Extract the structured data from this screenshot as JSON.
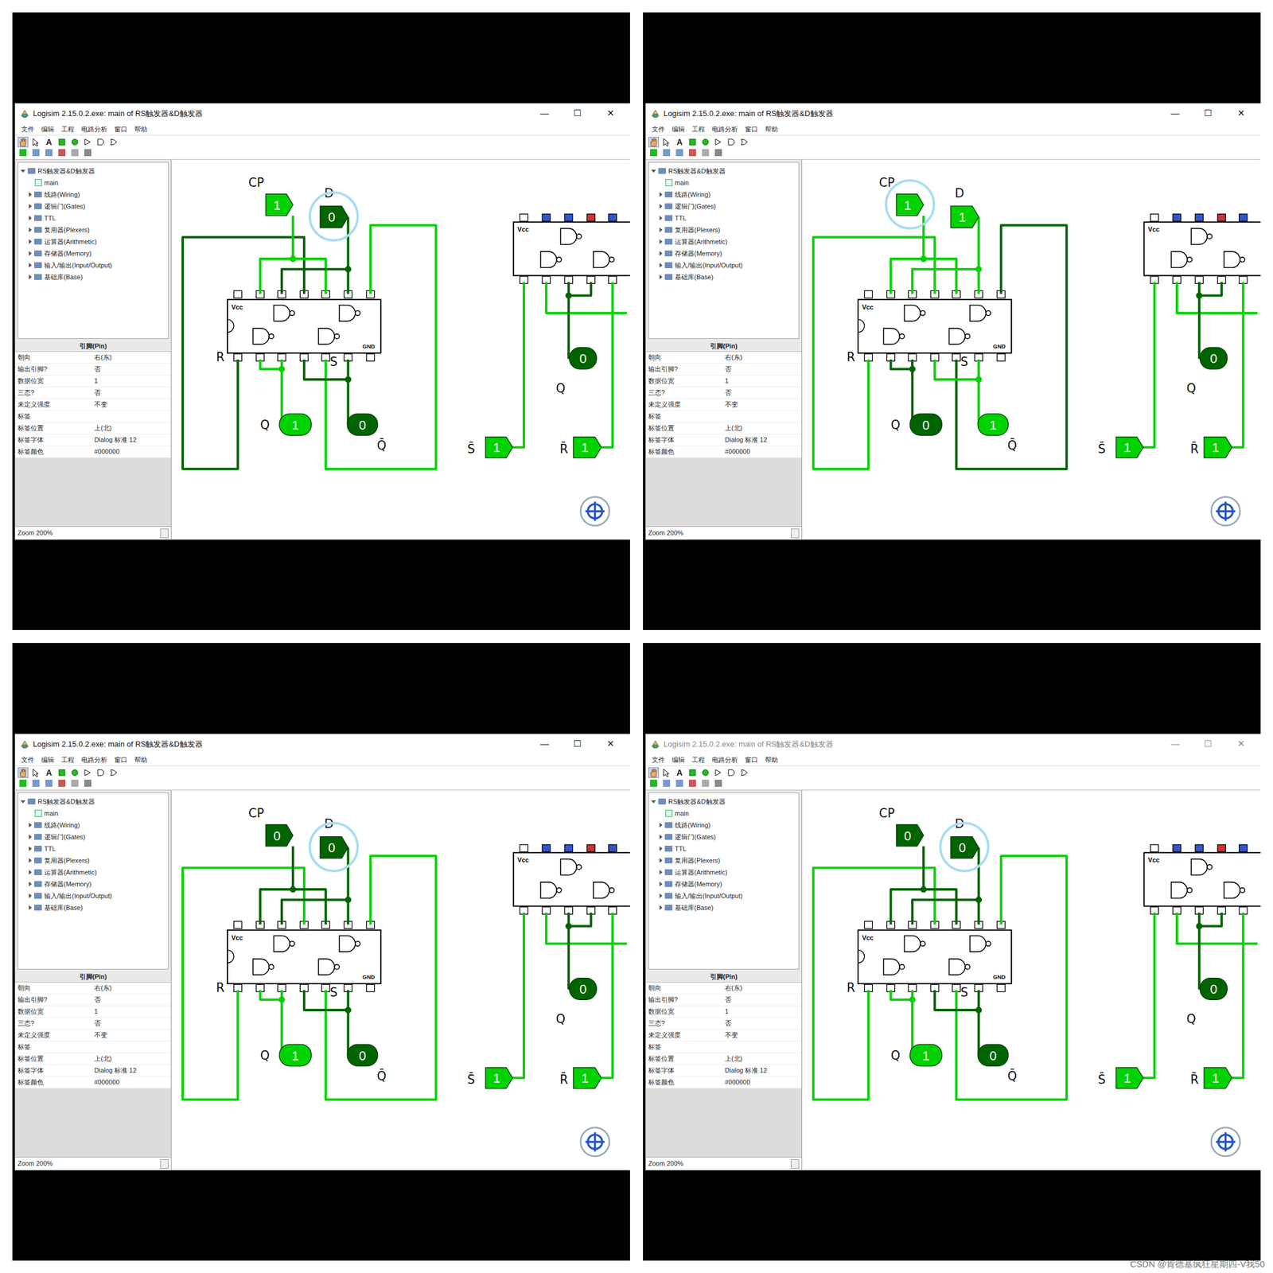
{
  "window": {
    "title": "Logisim 2.15.0.2.exe: main of RS触发器&D触发器",
    "controls": [
      "—",
      "☐",
      "✕"
    ],
    "menu": [
      "文件",
      "编辑",
      "工程",
      "电路分析",
      "窗口",
      "帮助"
    ],
    "tools": [
      {
        "kind": "hand",
        "selected": true
      },
      {
        "kind": "pointer",
        "selected": false
      },
      {
        "kind": "text",
        "label": "A",
        "selected": false
      },
      {
        "kind": "input",
        "selected": false
      },
      {
        "kind": "output",
        "selected": false
      },
      {
        "kind": "not",
        "selected": false
      },
      {
        "kind": "and",
        "selected": false
      },
      {
        "kind": "or",
        "selected": false
      }
    ],
    "tree": {
      "root": "RS触发器&D触发器",
      "items": [
        {
          "label": "main",
          "kind": "circuit"
        },
        {
          "label": "线路(Wiring)",
          "kind": "folder"
        },
        {
          "label": "逻辑门(Gates)",
          "kind": "folder"
        },
        {
          "label": "TTL",
          "kind": "folder"
        },
        {
          "label": "复用器(Plexers)",
          "kind": "folder"
        },
        {
          "label": "运算器(Arithmetic)",
          "kind": "folder"
        },
        {
          "label": "存储器(Memory)",
          "kind": "folder"
        },
        {
          "label": "输入/输出(Input/Output)",
          "kind": "folder"
        },
        {
          "label": "基础库(Base)",
          "kind": "folder"
        }
      ]
    },
    "properties": {
      "title": "引脚(Pin)",
      "rows": [
        [
          "朝向",
          "右(东)"
        ],
        [
          "输出引脚?",
          "否"
        ],
        [
          "数据位宽",
          "1"
        ],
        [
          "三态?",
          "否"
        ],
        [
          "未定义强度",
          "不变"
        ],
        [
          "标签",
          ""
        ],
        [
          "标签位置",
          "上(北)"
        ],
        [
          "标签字体",
          "Dialog 标准 12"
        ],
        [
          "标签颜色",
          "#000000"
        ]
      ]
    },
    "zoom": "Zoom 200%"
  },
  "circuit": {
    "labels": {
      "cp": "CP",
      "d": "D",
      "r": "R",
      "s": "S",
      "q": "Q",
      "qbar": "Q̄",
      "q2": "Q",
      "sbar": "S̄",
      "rbar": "R̄"
    },
    "chip": {
      "vcc": "Vcc",
      "gnd": "GND"
    }
  },
  "panels": [
    {
      "active": true,
      "focus": "d",
      "pins": {
        "cp": "1",
        "d": "0",
        "q": "1",
        "qbar": "0",
        "q2": "0",
        "sbar": "1",
        "rbar": "1"
      },
      "wires": {
        "left_loop": false,
        "right_loop": true,
        "right_feedback": true
      }
    },
    {
      "active": true,
      "focus": "cp",
      "pins": {
        "cp": "1",
        "d": "1",
        "q": "0",
        "qbar": "1",
        "q2": "0",
        "sbar": "1",
        "rbar": "1"
      },
      "wires": {
        "left_loop": true,
        "right_loop": false,
        "right_feedback": true
      }
    },
    {
      "active": true,
      "focus": "d",
      "pins": {
        "cp": "0",
        "d": "0",
        "q": "1",
        "qbar": "0",
        "q2": "0",
        "sbar": "1",
        "rbar": "1"
      },
      "wires": {
        "left_loop": true,
        "right_loop": true,
        "right_feedback": true
      }
    },
    {
      "active": false,
      "focus": "d",
      "pins": {
        "cp": "0",
        "d": "0",
        "q": "1",
        "qbar": "0",
        "q2": "0",
        "sbar": "1",
        "rbar": "1"
      },
      "wires": {
        "left_loop": true,
        "right_loop": true,
        "right_feedback": true
      }
    }
  ],
  "watermark": "CSDN @肯德基疯狂星期四-V我50"
}
